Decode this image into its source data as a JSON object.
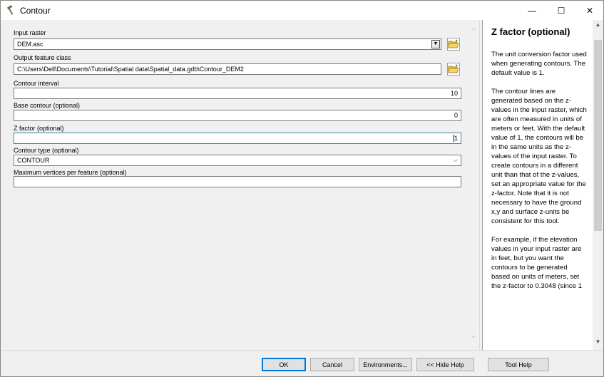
{
  "window": {
    "title": "Contour",
    "minimize": "—",
    "maximize": "☐",
    "close": "✕"
  },
  "form": {
    "input_raster": {
      "label": "Input raster",
      "value": "DEM.asc"
    },
    "output_feature_class": {
      "label": "Output feature class",
      "value": "C:\\Users\\Dell\\Documents\\Tutorial\\Spatial data\\Spatial_data.gdb\\Contour_DEM2"
    },
    "contour_interval": {
      "label": "Contour interval",
      "value": "10"
    },
    "base_contour": {
      "label": "Base contour (optional)",
      "value": "0"
    },
    "z_factor": {
      "label": "Z factor (optional)",
      "value": "1"
    },
    "contour_type": {
      "label": "Contour type (optional)",
      "value": "CONTOUR"
    },
    "max_vertices": {
      "label": "Maximum vertices per feature (optional)",
      "value": ""
    }
  },
  "help": {
    "title": "Z factor (optional)",
    "paragraphs": [
      "The unit conversion factor used when generating contours. The default value is 1.",
      "The contour lines are generated based on the z-values in the input raster, which are often measured in units of meters or feet. With the default value of 1, the contours will be in the same units as the z-values of the input raster. To create contours in a different unit than that of the z-values, set an appropriate value for the z-factor. Note that it is not necessary to have the ground x,y and surface z-units be consistent for this tool.",
      "For example, if the elevation values in your input raster are in feet, but you want the contours to be generated based on units of meters, set the z-factor to 0.3048 (since 1"
    ]
  },
  "buttons": {
    "ok": "OK",
    "cancel": "Cancel",
    "environments": "Environments...",
    "hide_help": "<< Hide Help",
    "tool_help": "Tool Help"
  },
  "icons": {
    "window": "hammer-icon",
    "browse": "open-folder-icon"
  }
}
